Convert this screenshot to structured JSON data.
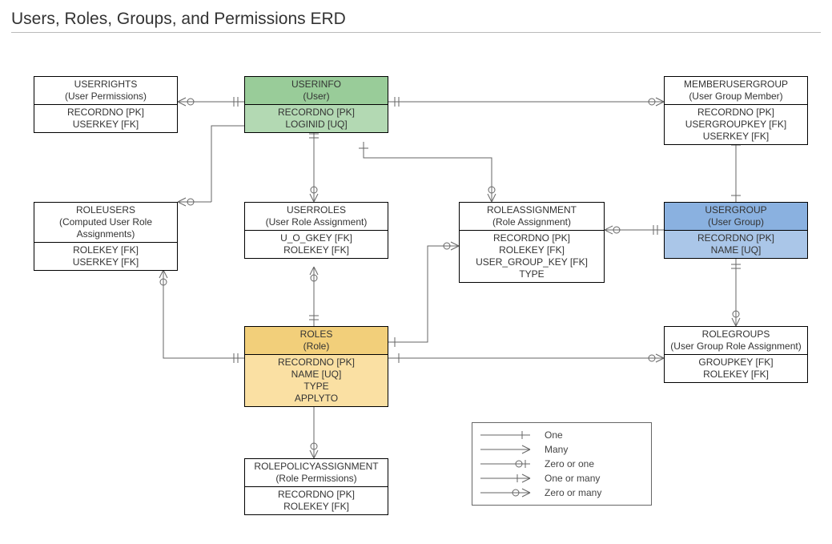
{
  "page": {
    "title": "Users, Roles, Groups, and Permissions ERD"
  },
  "entities": {
    "userrights": {
      "name": "USERRIGHTS",
      "sub": "(User Permissions)",
      "attrs": [
        "RECORDNO [PK]",
        "USERKEY [FK]"
      ]
    },
    "userinfo": {
      "name": "USERINFO",
      "sub": "(User)",
      "attrs": [
        "RECORDNO [PK]",
        "LOGINID [UQ]"
      ]
    },
    "memberusergroup": {
      "name": "MEMBERUSERGROUP",
      "sub": "(User Group Member)",
      "attrs": [
        "RECORDNO [PK]",
        "USERGROUPKEY [FK]",
        "USERKEY [FK]"
      ]
    },
    "roleusers": {
      "name": "ROLEUSERS",
      "sub": "(Computed User Role Assignments)",
      "attrs": [
        "ROLEKEY [FK]",
        "USERKEY [FK]"
      ]
    },
    "userroles": {
      "name": "USERROLES",
      "sub": "(User Role Assignment)",
      "attrs": [
        "U_O_GKEY [FK]",
        "ROLEKEY [FK]"
      ]
    },
    "roleassignment": {
      "name": "ROLEASSIGNMENT",
      "sub": "(Role Assignment)",
      "attrs": [
        "RECORDNO [PK]",
        "ROLEKEY [FK]",
        "USER_GROUP_KEY [FK]",
        "TYPE"
      ]
    },
    "usergroup": {
      "name": "USERGROUP",
      "sub": "(User Group)",
      "attrs": [
        "RECORDNO [PK]",
        "NAME [UQ]"
      ]
    },
    "roles": {
      "name": "ROLES",
      "sub": "(Role)",
      "attrs": [
        "RECORDNO [PK]",
        "NAME [UQ]",
        "TYPE",
        "APPLYTO"
      ]
    },
    "rolegroups": {
      "name": "ROLEGROUPS",
      "sub": "(User Group Role Assignment)",
      "attrs": [
        "GROUPKEY [FK]",
        "ROLEKEY [FK]"
      ]
    },
    "rolepolicyassignment": {
      "name": "ROLEPOLICYASSIGNMENT",
      "sub": "(Role Permissions)",
      "attrs": [
        "RECORDNO [PK]",
        "ROLEKEY [FK]"
      ]
    }
  },
  "legend": {
    "one": "One",
    "many": "Many",
    "zero_or_one": "Zero or one",
    "one_or_many": "One or many",
    "zero_or_many": "Zero or many"
  }
}
